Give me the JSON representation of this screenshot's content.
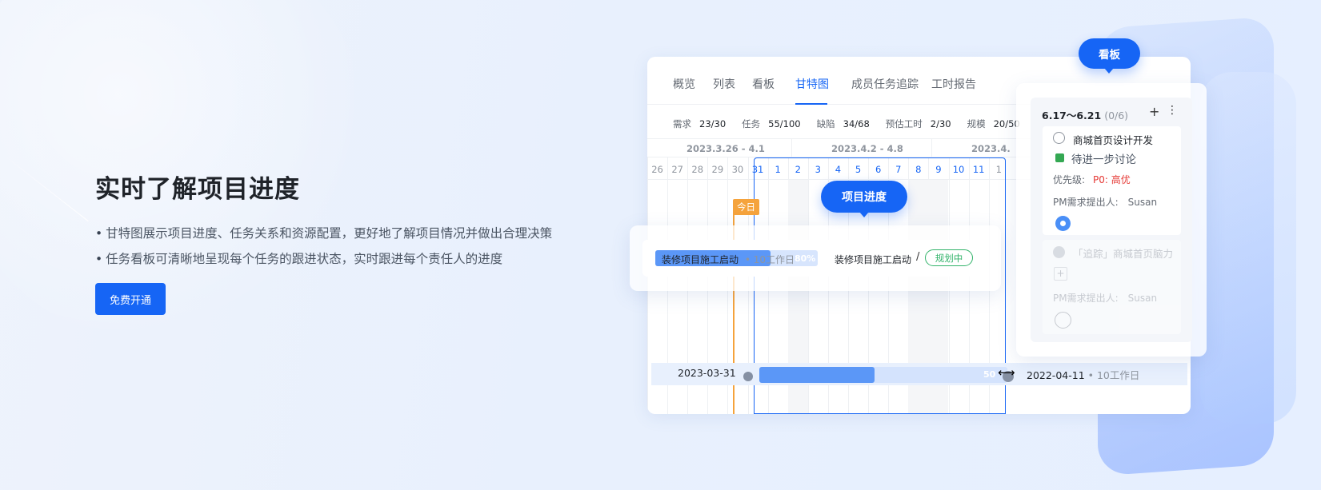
{
  "hero": {
    "title": "实时了解项目进度",
    "bullets": [
      "甘特图展示项目进度、任务关系和资源配置，更好地了解项目情况并做出合理决策",
      "任务看板可清晰地呈现每个任务的跟进状态，实时跟进每个责任人的进度"
    ],
    "cta_label": "免费开通"
  },
  "tabs": [
    "概览",
    "列表",
    "看板",
    "甘特图",
    "成员任务追踪",
    "工时报告"
  ],
  "active_tab": "甘特图",
  "stats": [
    {
      "label": "需求",
      "value": "23/30"
    },
    {
      "label": "任务",
      "value": "55/100"
    },
    {
      "label": "缺陷",
      "value": "34/68"
    },
    {
      "label": "预估工时",
      "value": "2/30"
    },
    {
      "label": "规模",
      "value": "20/50"
    }
  ],
  "weeks": [
    "2023.3.26 - 4.1",
    "2023.4.2 - 4.8",
    "2023.4."
  ],
  "days": [
    "26",
    "27",
    "28",
    "29",
    "30",
    "31",
    "1",
    "2",
    "3",
    "4",
    "5",
    "6",
    "7",
    "8",
    "9",
    "10",
    "11",
    "1"
  ],
  "today_label": "今日",
  "progress_tooltip": "项目进度",
  "task_bar": {
    "name": "装修项目施工启动",
    "duration": "10工作日",
    "percent": "80%",
    "side_name": "装修项目施工启动",
    "separator": "/",
    "status": "规划中"
  },
  "bottom_bar": {
    "start_date": "2023-03-31",
    "percent": "50",
    "end_date": "2022-04-11",
    "duration": "10工作日",
    "progress_fraction": 0.5
  },
  "kanban": {
    "tooltip": "看板",
    "range": "6.17～6.21",
    "count": "(0/6)",
    "add": "+",
    "more": "⋮",
    "card1": {
      "title": "商城首页设计开发",
      "status": "待进一步讨论",
      "priority_label": "优先级:",
      "priority_value": "P0: 高优",
      "pm_label": "PM需求提出人:",
      "pm_value": "Susan"
    },
    "card2": {
      "title": "「追踪」商城首页脑力",
      "add": "+",
      "pm_label": "PM需求提出人:",
      "pm_value": "Susan"
    }
  }
}
